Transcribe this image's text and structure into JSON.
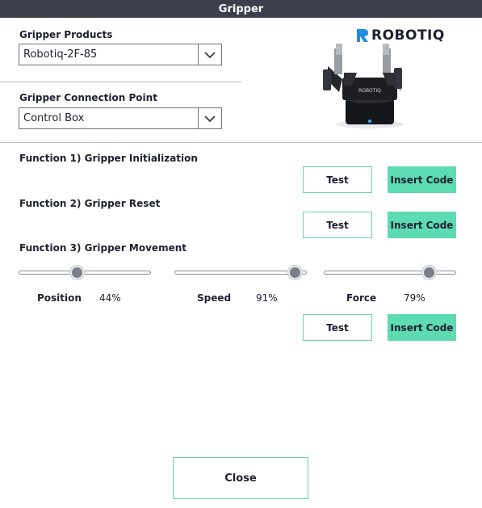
{
  "window": {
    "title": "Gripper"
  },
  "products": {
    "label": "Gripper Products",
    "selected": "Robotiq-2F-85"
  },
  "connection": {
    "label": "Gripper Connection Point",
    "selected": "Control Box"
  },
  "brand": {
    "logo_text": "ROBOTIQ",
    "device_label": "ROBOTIQ"
  },
  "functions": [
    {
      "title": "Function 1)  Gripper Initialization",
      "test_label": "Test",
      "insert_label": "Insert Code"
    },
    {
      "title": "Function 2)  Gripper Reset",
      "test_label": "Test",
      "insert_label": "Insert Code"
    },
    {
      "title": "Function 3)  Gripper Movement",
      "test_label": "Test",
      "insert_label": "Insert Code"
    }
  ],
  "sliders": {
    "position": {
      "label": "Position",
      "value_text": "44%",
      "value": 0.44
    },
    "speed": {
      "label": "Speed",
      "value_text": "91%",
      "value": 0.91
    },
    "force": {
      "label": "Force",
      "value_text": "79%",
      "value": 0.79
    }
  },
  "footer": {
    "close_label": "Close"
  },
  "colors": {
    "accent": "#5ddbb3",
    "accent_border": "#63d6b1",
    "titlebar": "#3b3f4c",
    "logo_blue": "#1f8fe0",
    "slider_thumb": "#7b7e86"
  },
  "icons": {
    "dropdown": "chevron-down-icon",
    "logo": "robotiq-logo-icon"
  }
}
